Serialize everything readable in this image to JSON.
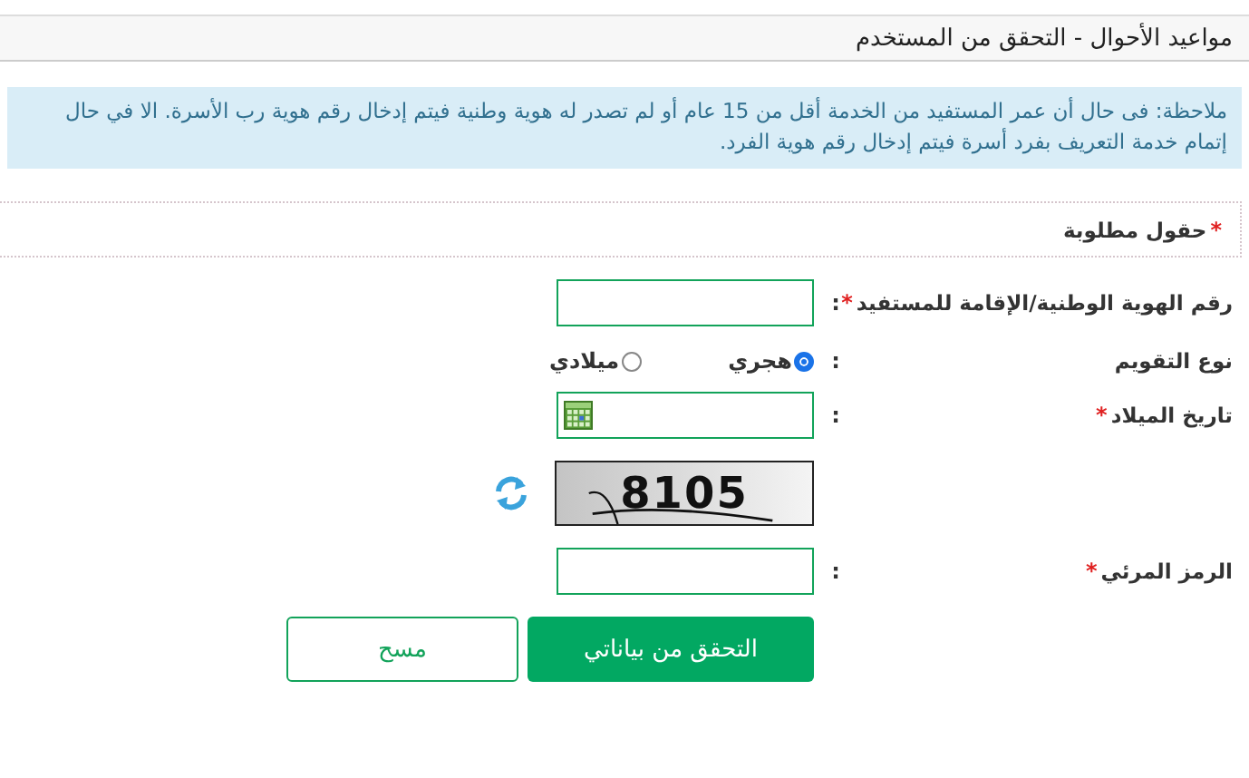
{
  "header": {
    "title": "مواعيد الأحوال - التحقق من المستخدم"
  },
  "note": "ملاحظة: فى حال أن عمر المستفيد من الخدمة أقل من 15 عام أو لم تصدر له هوية وطنية فيتم إدخال رقم هوية رب الأسرة. الا في حال إتمام خدمة التعريف بفرد أسرة فيتم إدخال رقم هوية الفرد.",
  "required_legend": {
    "marker": "*",
    "text": "حقول مطلوبة"
  },
  "fields": [
    {
      "kind": "text",
      "label": "رقم الهوية الوطنية/الإقامة للمستفيد",
      "marker": "*",
      "separator": ":"
    },
    {
      "kind": "radio",
      "label": "نوع التقويم",
      "separator": ":",
      "options": [
        {
          "label": "هجري",
          "selected": true
        },
        {
          "label": "ميلادي",
          "selected": false
        }
      ]
    },
    {
      "kind": "date",
      "label": "تاريخ الميلاد",
      "marker": "*",
      "separator": ":"
    },
    {
      "kind": "captcha",
      "code": "8105"
    },
    {
      "kind": "text",
      "label": "الرمز المرئي",
      "marker": "*",
      "separator": ":"
    }
  ],
  "buttons": [
    {
      "label": "التحقق من بياناتي",
      "kind": "primary"
    },
    {
      "label": "مسح",
      "kind": "secondary"
    }
  ]
}
